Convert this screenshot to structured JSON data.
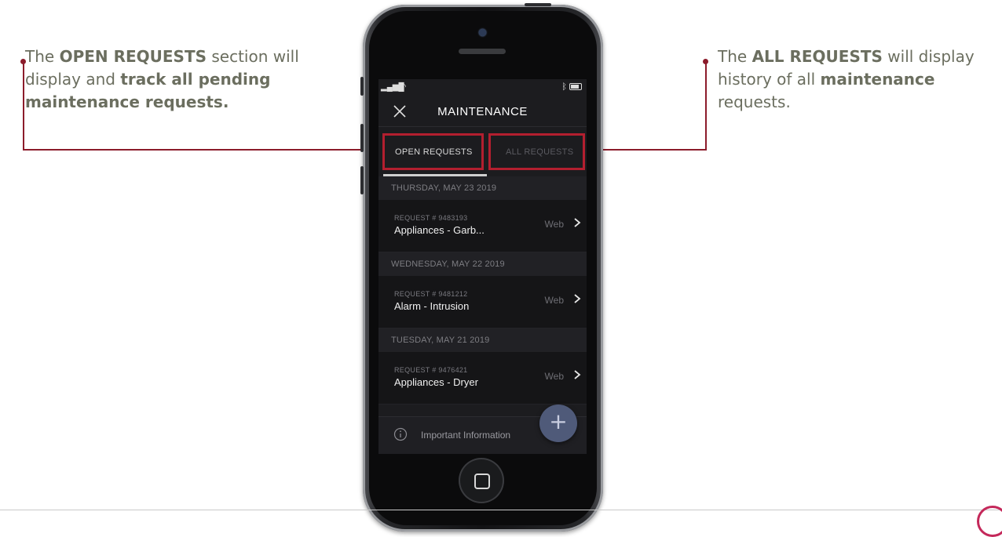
{
  "callouts": {
    "left": {
      "pre": "The ",
      "bold1": "OPEN REQUESTS",
      "mid": " section will display and ",
      "bold2": "track all pending maintenance requests."
    },
    "right": {
      "pre": "The ",
      "bold1": "ALL REQUESTS",
      "mid": " will display history of all ",
      "bold2": "maintenance",
      "post": " requests."
    }
  },
  "app": {
    "title": "MAINTENANCE",
    "tabs": [
      {
        "label": "OPEN REQUESTS",
        "active": true
      },
      {
        "label": "ALL REQUESTS",
        "active": false
      }
    ],
    "groups": [
      {
        "date": "THURSDAY, MAY 23 2019",
        "request_number": "REQUEST # 9483193",
        "name": "Appliances - Garb...",
        "source": "Web"
      },
      {
        "date": "WEDNESDAY, MAY 22 2019",
        "request_number": "REQUEST # 9481212",
        "name": "Alarm - Intrusion",
        "source": "Web"
      },
      {
        "date": "TUESDAY, MAY 21 2019",
        "request_number": "REQUEST # 9476421",
        "name": "Appliances - Dryer",
        "source": "Web"
      }
    ],
    "footer_label": "Important Information",
    "fab_symbol": "+"
  },
  "icons": {
    "close": "close-icon",
    "chevron": "chevron-right-icon",
    "info": "info-icon",
    "add": "plus-icon"
  },
  "colors": {
    "callout_accent": "#8c1c2b",
    "highlight_box": "#b31f2f",
    "screen_bg": "#1c1c1f",
    "fab": "#4f5a79"
  }
}
